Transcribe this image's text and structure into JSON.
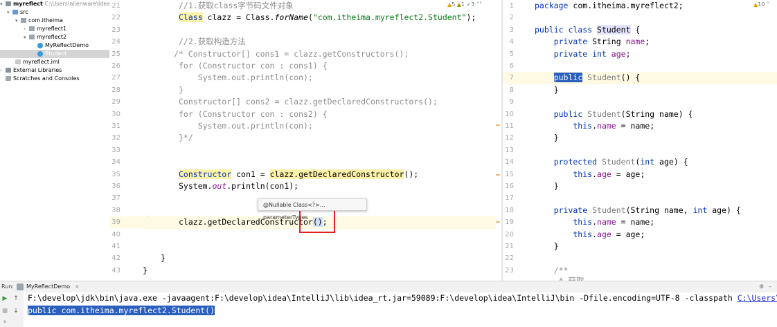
{
  "project_tree": {
    "root_name": "myreflect",
    "root_path": "C:\\Users\\alienware\\IdeaProj",
    "items": [
      {
        "label": "src"
      },
      {
        "label": "com.itheima"
      },
      {
        "label": "myreflect1"
      },
      {
        "label": "myreflect2"
      },
      {
        "label": "MyReflectDemo"
      },
      {
        "label": "Student"
      },
      {
        "label": "myreflect.iml"
      },
      {
        "label": "External Libraries"
      },
      {
        "label": "Scratches and Consoles"
      }
    ]
  },
  "left_editor": {
    "inspections": {
      "warnings": "5",
      "weak": "1",
      "typos": "3"
    },
    "line_numbers": [
      "21",
      "22",
      "23",
      "24",
      "25",
      "26",
      "27",
      "28",
      "29",
      "30",
      "31",
      "32",
      "33",
      "34",
      "35",
      "36",
      "37",
      "38",
      "39",
      "40",
      "41",
      "42",
      "43"
    ],
    "code": {
      "l21": "//1.获取class字节码文件对象",
      "l22_a": "Class",
      "l22_b": " clazz = Class.",
      "l22_c": "forName",
      "l22_d": "(",
      "l22_e": "\"com.itheima.myreflect2.Student\"",
      "l22_f": ");",
      "l24": "//2.获取构造方法",
      "l25": "/* Constructor[] cons1 = clazz.getConstructors();",
      "l26": "for (Constructor con : cons1) {",
      "l27": "    System.out.println(con);",
      "l28": "}",
      "l29": "Constructor[] cons2 = clazz.getDeclaredConstructors();",
      "l30": "for (Constructor con : cons2) {",
      "l31": "    System.out.println(con);",
      "l32": "}*/",
      "l35_a": "Constructor",
      "l35_b": " con1 = ",
      "l35_c": "clazz.getDeclaredConstructor",
      "l35_d": "();",
      "l36_a": "System.",
      "l36_b": "out",
      "l36_c": ".println(con1);",
      "l39_a": "clazz.getDeclaredConstructor",
      "l39_b": "()",
      "l39_c": ";",
      "l42": "}",
      "l43": "}"
    },
    "tooltip": "@Nullable Class<?>... parameterTypes"
  },
  "right_editor": {
    "inspections": {
      "warnings": "10"
    },
    "line_numbers": [
      "1",
      "2",
      "3",
      "4",
      "5",
      "6",
      "7",
      "8",
      "9",
      "10",
      "11",
      "12",
      "13",
      "14",
      "15",
      "16",
      "17",
      "18",
      "19",
      "20",
      "21",
      "22",
      "23",
      "24"
    ],
    "code": {
      "l1_a": "package",
      "l1_b": " com.itheima.myreflect2;",
      "l3_a": "public class",
      "l3_b": "Student",
      "l3_c": " {",
      "l4_a": "    private",
      "l4_b": " String ",
      "l4_c": "name",
      "l4_d": ";",
      "l5_a": "    private int",
      "l5_b": " ",
      "l5_c": "age",
      "l5_d": ";",
      "l7_a": "public",
      "l7_b": " Student",
      "l7_c": "() {",
      "l8": "    }",
      "l10_a": "    public",
      "l10_b": " Student",
      "l10_c": "(String name) {",
      "l11_a": "        this",
      "l11_b": ".",
      "l11_c": "name",
      "l11_d": " = name;",
      "l12": "    }",
      "l14_a": "    protected",
      "l14_b": " Student",
      "l14_c": "(",
      "l14_d": "int",
      "l14_e": " age) {",
      "l15_a": "        this",
      "l15_b": ".",
      "l15_c": "age",
      "l15_d": " = age;",
      "l16": "    }",
      "l18_a": "    private",
      "l18_b": " Student",
      "l18_c": "(String name, ",
      "l18_d": "int",
      "l18_e": " age) {",
      "l19_a": "        this",
      "l19_b": ".",
      "l19_c": "name",
      "l19_d": " = name;",
      "l20_a": "        this",
      "l20_b": ".",
      "l20_c": "age",
      "l20_d": " = age;",
      "l21": "    }",
      "l23": "    /**",
      "l24": "     * 获取"
    }
  },
  "run_panel": {
    "label": "Run:",
    "tab": "MyReflectDemo",
    "line1_a": "F:\\develop\\jdk\\bin\\java.exe -javaagent:F:\\develop\\idea\\IntelliJ\\lib\\idea_rt.jar=59089:F:\\develop\\idea\\IntelliJ\\bin -Dfile.encoding=UTF-8 -classpath ",
    "line1_link": "C:\\Users\\alienwa",
    "line2": "public com.itheima.myreflect2.Student()"
  },
  "colors": {
    "keyword": "#0033b3",
    "string": "#067d17",
    "comment": "#8c8c8c",
    "field": "#871094",
    "highlight": "#fcf2a8",
    "selection": "#2a5fbf",
    "annotation_box": "#e02020"
  }
}
